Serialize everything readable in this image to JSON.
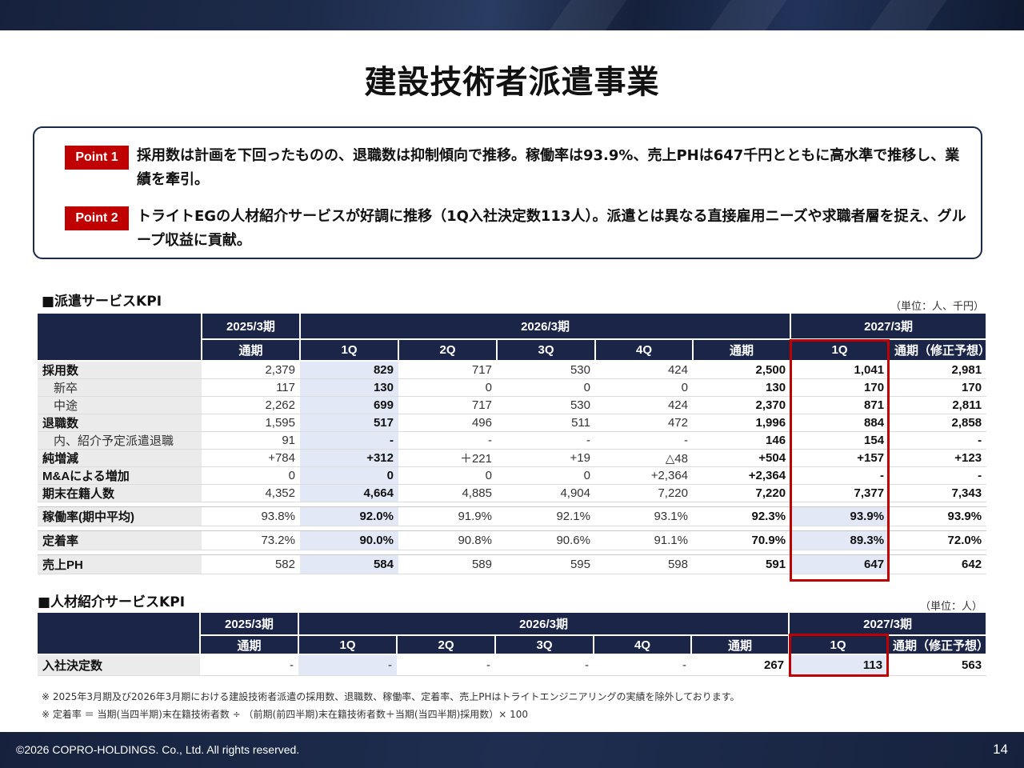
{
  "title": "建設技術者派遣事業",
  "points": [
    {
      "tag": "Point 1",
      "text": "採用数は計画を下回ったものの、退職数は抑制傾向で推移。稼働率は93.9%、売上PHは647千円とともに高水準で推移し、業績を牽引。"
    },
    {
      "tag": "Point 2",
      "text": "トライトEGの人材紹介サービスが好調に推移（1Q入社決定数113人）。派遣とは異なる直接雇用ニーズや求職者層を捉え、グループ収益に貢献。"
    }
  ],
  "dispatch": {
    "title": "■派遣サービスKPI",
    "unit": "（単位：人、千円）",
    "periods": [
      "2025/3期",
      "2026/3期",
      "2027/3期"
    ],
    "cols": [
      "通期",
      "1Q",
      "2Q",
      "3Q",
      "4Q",
      "通期",
      "1Q",
      "通期（修正予想）"
    ],
    "rows": [
      {
        "label": "採用数",
        "sub": false,
        "values": [
          "2,379",
          "829",
          "717",
          "530",
          "424",
          "2,500",
          "1,041",
          "2,981"
        ]
      },
      {
        "label": "新卒",
        "sub": true,
        "values": [
          "117",
          "130",
          "0",
          "0",
          "0",
          "130",
          "170",
          "170"
        ]
      },
      {
        "label": "中途",
        "sub": true,
        "values": [
          "2,262",
          "699",
          "717",
          "530",
          "424",
          "2,370",
          "871",
          "2,811"
        ]
      },
      {
        "label": "退職数",
        "sub": false,
        "values": [
          "1,595",
          "517",
          "496",
          "511",
          "472",
          "1,996",
          "884",
          "2,858"
        ]
      },
      {
        "label": "内、紹介予定派遣退職",
        "sub": true,
        "values": [
          "91",
          "-",
          "-",
          "-",
          "-",
          "146",
          "154",
          "-"
        ]
      },
      {
        "label": "純増減",
        "sub": false,
        "values": [
          "+784",
          "+312",
          "＋221",
          "+19",
          "△48",
          "+504",
          "+157",
          "+123"
        ]
      },
      {
        "label": "M&Aによる増加",
        "sub": false,
        "values": [
          "0",
          "0",
          "0",
          "0",
          "+2,364",
          "+2,364",
          "-",
          "-"
        ]
      },
      {
        "label": "期末在籍人数",
        "sub": false,
        "values": [
          "4,352",
          "4,664",
          "4,885",
          "4,904",
          "7,220",
          "7,220",
          "7,377",
          "7,343"
        ]
      }
    ],
    "rows2": [
      {
        "label": "稼働率(期中平均)",
        "values": [
          "93.8%",
          "92.0%",
          "91.9%",
          "92.1%",
          "93.1%",
          "92.3%",
          "93.9%",
          "93.9%"
        ]
      },
      {
        "label": "定着率",
        "values": [
          "73.2%",
          "90.0%",
          "90.8%",
          "90.6%",
          "91.1%",
          "70.9%",
          "89.3%",
          "72.0%"
        ]
      },
      {
        "label": "売上PH",
        "values": [
          "582",
          "584",
          "589",
          "595",
          "598",
          "591",
          "647",
          "642"
        ]
      }
    ]
  },
  "placement": {
    "title": "■人材紹介サービスKPI",
    "unit": "（単位：人）",
    "periods": [
      "2025/3期",
      "2026/3期",
      "2027/3期"
    ],
    "cols": [
      "通期",
      "1Q",
      "2Q",
      "3Q",
      "4Q",
      "通期",
      "1Q",
      "通期（修正予想）"
    ],
    "row": {
      "label": "入社決定数",
      "values": [
        "-",
        "-",
        "-",
        "-",
        "-",
        "267",
        "113",
        "563"
      ]
    }
  },
  "notes": [
    "※ 2025年3月期及び2026年3月期における建設技術者派遣の採用数、退職数、稼働率、定着率、売上PHはトライトエンジニアリングの実績を除外しております。",
    "※ 定着率 ＝ 当期(当四半期)末在籍技術者数 ÷ （前期(前四半期)末在籍技術者数＋当期(当四半期)採用数）× 100"
  ],
  "footer": {
    "copyright": "©2026 COPRO-HOLDINGS. Co., Ltd. All rights reserved.",
    "page": "14"
  },
  "colors": {
    "navy": "#1b2548",
    "accent_red": "#c00000",
    "q1_highlight": "#e3e8f6"
  }
}
